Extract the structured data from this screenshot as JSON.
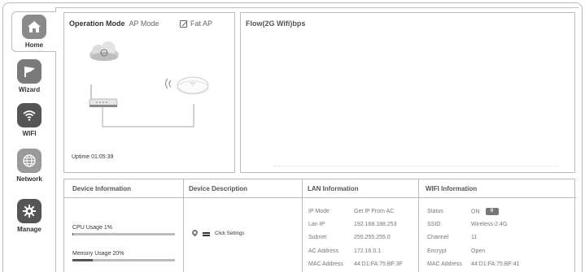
{
  "sidebar": {
    "items": [
      {
        "label": "Home",
        "icon": "home-icon",
        "active": true
      },
      {
        "label": "Wizard",
        "icon": "flag-icon"
      },
      {
        "label": "WIFI",
        "icon": "wifi-icon"
      },
      {
        "label": "Network",
        "icon": "globe-icon"
      },
      {
        "label": "Manage",
        "icon": "gear-icon"
      }
    ]
  },
  "operation": {
    "title": "Operation Mode",
    "mode": "AP Mode",
    "fat_ap": "Fat AP",
    "uptime": "Uptime 01:05:39"
  },
  "flow": {
    "title": "Flow(2G Wifi)bps"
  },
  "device_info": {
    "title": "Device Information",
    "cpu_label": "CPU Usage   1%",
    "cpu_percent": 1,
    "memory_label": "Memory Usage   20%",
    "memory_percent": 20
  },
  "device_desc": {
    "title": "Device Description",
    "click_settings": "Click Settings"
  },
  "lan": {
    "title": "LAN Information",
    "rows": [
      {
        "key": "IP Mode",
        "value": "Get IP From AC"
      },
      {
        "key": "Lan IP",
        "value": "192.168.188.253"
      },
      {
        "key": "Subnet",
        "value": "255.255.255.0"
      },
      {
        "key": "AC Address",
        "value": "172.16.0.1"
      },
      {
        "key": "MAC Address",
        "value": "44:D1:FA:75:BF:3F"
      }
    ]
  },
  "wifi": {
    "title": "WIFI Information",
    "status_label": "Status",
    "status_value": "ON",
    "toggle_value": "0",
    "rows": [
      {
        "key": "SSID",
        "value": "Wireless-2.4G"
      },
      {
        "key": "Channel",
        "value": "11"
      },
      {
        "key": "Encrypt",
        "value": "Open"
      },
      {
        "key": "MAC Address",
        "value": "44:D1:FA:75:BF:41"
      }
    ]
  },
  "colors": {
    "border": "#bdbdbd",
    "icon_dark": "#555555",
    "bar_track": "#bcbcbd",
    "bar_fill": "#555555"
  }
}
